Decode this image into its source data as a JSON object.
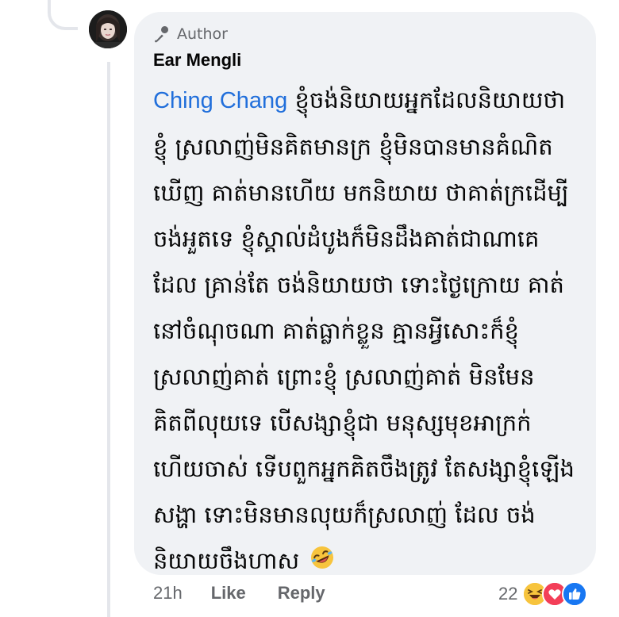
{
  "comment": {
    "badge_label": "Author",
    "author_name": "Ear Mengli",
    "mention": "Ching Chang",
    "text": "ខ្ញុំចង់និយាយអ្នកដែលនិយាយថាខ្ញុំ ស្រលាញ់មិនគិតមានក្រ ខ្ញុំមិនបានមានគំណិតឃើញ គាត់មានហើយ មកនិយាយ ថាគាត់ក្រដើម្បីចង់អួតទេ ខ្ញុំស្គាល់ដំបូងក៏មិនដឹងគាត់ជាណាគេដែល គ្រាន់តែ ចង់និយាយថា ទោះថ្ងៃក្រោយ គាត់នៅចំណុចណា គាត់ធ្លាក់ខ្លួន គ្មានអ្វីសោះក៏ខ្ញុំស្រលាញ់គាត់ ព្រោះខ្ញុំ ស្រលាញ់គាត់ មិនមែនគិតពីលុយទេ បើសង្សាខ្ញុំជា មនុស្សមុខអាក្រក់ហើយចាស់ ទើបពួកអ្នកគិតចឹងត្រូវ តែសង្សាខ្ញុំឡើងសង្ហា ទោះមិនមានលុយក៏ស្រលាញ់ ដែល ចង់និយាយចឹងហាស",
    "trailing_emoji": "rolling-on-floor-laughing"
  },
  "actions": {
    "time": "21h",
    "like": "Like",
    "reply": "Reply"
  },
  "reactions": {
    "count": "22",
    "types": [
      "haha",
      "love",
      "like"
    ]
  },
  "colors": {
    "bubble_bg": "#f0f2f5",
    "mention": "#216fdb",
    "muted": "#65676b",
    "text": "#050505"
  }
}
